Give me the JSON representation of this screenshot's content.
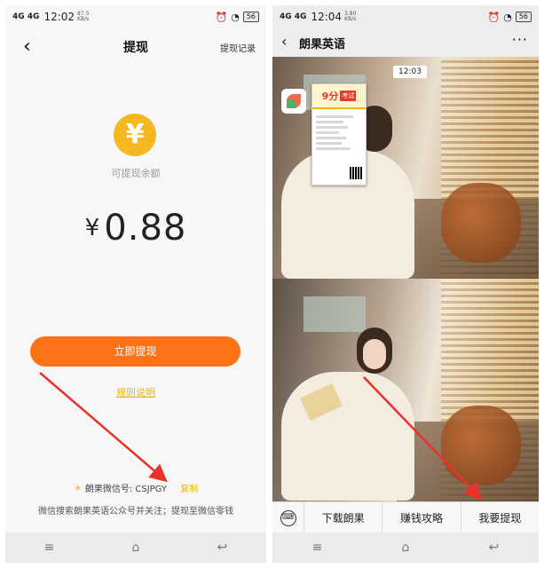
{
  "left": {
    "status": {
      "signal": "4G 4G",
      "time": "12:02",
      "speed": "87.5 KB/s",
      "battery": "56"
    },
    "nav": {
      "back_icon": "‹",
      "title": "提现",
      "record_link": "提现记录"
    },
    "coin_symbol": "¥",
    "balance_label": "可提现余额",
    "currency": "¥",
    "amount": "0.88",
    "withdraw_button": "立即提现",
    "rules_link": "规则说明",
    "wechat_label": "朗果微信号: CSJPGY",
    "copy_label": "复制",
    "hint": "微信搜索朗果英语公众号并关注；提现至微信零钱",
    "accent_color": "#fb7217"
  },
  "right": {
    "status": {
      "signal": "4G 4G",
      "time": "12:04",
      "speed": "3.80 KB/s",
      "battery": "56"
    },
    "nav": {
      "back_icon": "‹",
      "title": "朗果英语",
      "more_icon": "···"
    },
    "video_time": "12:03",
    "poster": {
      "number": "9分",
      "tag": "考试"
    },
    "menu": {
      "keyboard_icon": "⌨",
      "items": [
        "下载朗果",
        "赚钱攻略",
        "我要提现"
      ]
    }
  },
  "sysbar": {
    "menu_icon": "≡",
    "home_icon": "⌂",
    "back_icon": "↩"
  }
}
